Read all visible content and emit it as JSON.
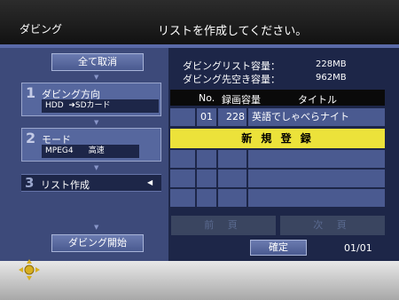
{
  "header": {
    "title": "ダビング",
    "instruction": "リストを作成してください。"
  },
  "left_panel": {
    "clear_all_label": "全て取消",
    "steps": [
      {
        "number": "1",
        "label": "ダビング方向",
        "value": "HDD  ➜SDカード"
      },
      {
        "number": "2",
        "label": "モード",
        "value": "MPEG4      高速"
      },
      {
        "number": "3",
        "label": "リスト作成"
      }
    ],
    "start_label": "ダビング開始"
  },
  "capacity": {
    "list_label": "ダビングリスト容量：",
    "list_value": "228MB",
    "dest_label": "ダビング先空き容量：",
    "dest_value": "962MB"
  },
  "table": {
    "headers": {
      "no": "No.",
      "size": "録画容量",
      "title": "タイトル"
    },
    "rows": [
      {
        "no": "01",
        "size": "228",
        "title": "英語でしゃべらナイト"
      }
    ],
    "register_label": "新 規 登 録"
  },
  "nav": {
    "prev_label": "前 頁",
    "next_label": "次 頁",
    "confirm_label": "確定",
    "page_indicator": "01/01"
  },
  "icons": {
    "dpad": "dpad-icon",
    "step_selected_marker": "triangle-left-icon"
  },
  "colors": {
    "panel_left": "#3d4a7a",
    "panel_right": "#1d2648",
    "accent_yellow": "#ece23a",
    "button_blue": "#5a6a9e"
  }
}
